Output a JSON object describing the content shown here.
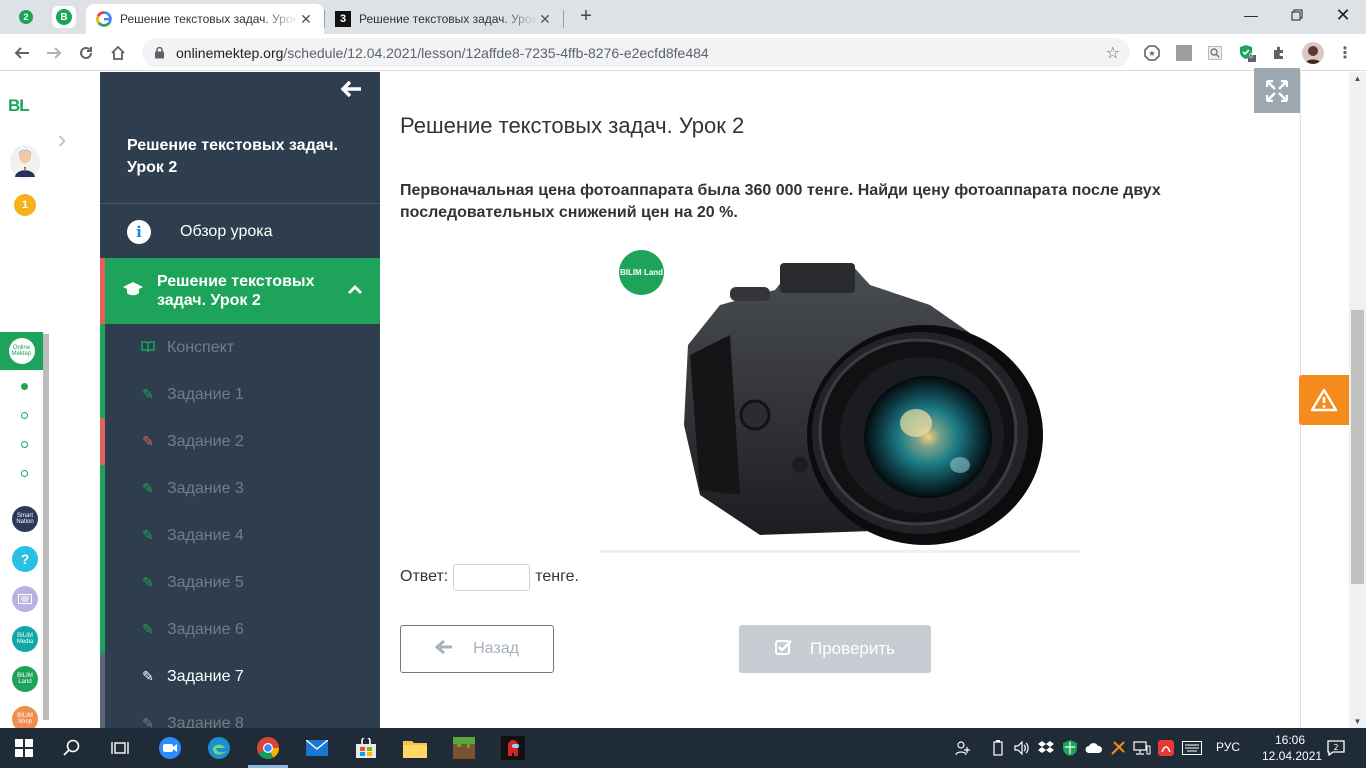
{
  "browser": {
    "pinned_tabs": [
      {
        "badge": "2",
        "name": "whatsapp-pinned"
      },
      {
        "badge": "B",
        "name": "bilimland-pinned"
      }
    ],
    "tabs": [
      {
        "title": "Решение текстовых задач. Урок 2",
        "favicon": "G",
        "active": true
      },
      {
        "title": "Решение текстовых задач. Урок 2",
        "favicon": "3",
        "active": false
      }
    ],
    "url_host": "onlinemektep.org",
    "url_path": "/schedule/12.04.2021/lesson/12affde8-7235-4ffb-8276-e2ecfd8fe484",
    "extension_badge": "0"
  },
  "rail": {
    "logo": "BL",
    "coins": "1"
  },
  "sidebar": {
    "title": "Решение текстовых задач. Урок 2",
    "overview_label": "Обзор урока",
    "section_label": "Решение текстовых задач. Урок 2",
    "items": [
      {
        "label": "Конспект",
        "state": "done"
      },
      {
        "label": "Задание 1",
        "state": "done"
      },
      {
        "label": "Задание 2",
        "state": "error"
      },
      {
        "label": "Задание 3",
        "state": "done"
      },
      {
        "label": "Задание 4",
        "state": "done"
      },
      {
        "label": "Задание 5",
        "state": "done"
      },
      {
        "label": "Задание 6",
        "state": "done"
      },
      {
        "label": "Задание 7",
        "state": "current"
      },
      {
        "label": "Задание 8",
        "state": "neutral"
      }
    ]
  },
  "main": {
    "lesson_title": "Решение текстовых задач. Урок 2",
    "question": "Первоначальная цена фотоаппарата была 360 000 тенге. Найди цену фотоаппарата после двух последовательных снижений цен на 20 %.",
    "image_badge": "BILIM Land",
    "answer_prefix": "Ответ:",
    "answer_value": "",
    "answer_suffix": "тенге.",
    "back_label": "Назад",
    "check_label": "Проверить"
  },
  "taskbar": {
    "language": "РУС",
    "time": "16:06",
    "date": "12.04.2021"
  },
  "colors": {
    "brand_green": "#1ea35a",
    "sidebar_bg": "#2e3e4e",
    "error_red": "#e4615a",
    "warning_orange": "#f48b1c"
  }
}
